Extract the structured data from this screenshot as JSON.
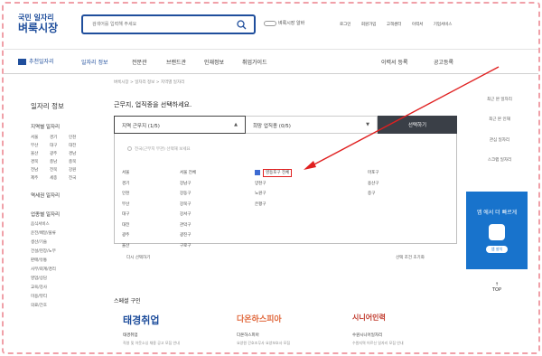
{
  "logo": {
    "line1": "국민 일자리",
    "line2": "벼룩시장"
  },
  "search": {
    "placeholder": "검색어를 입력해 주세요"
  },
  "header": {
    "chip": "벼룩시장 알바",
    "links": [
      "로그인",
      "회원가입",
      "고객센터",
      "이력서",
      "기업서비스"
    ]
  },
  "nav": {
    "first": "추천일자리",
    "items": [
      "일자리 정보",
      "전문관",
      "브랜드관",
      "인재정보",
      "취업가이드"
    ],
    "right": [
      "이력서 등록",
      "공고등록"
    ]
  },
  "breadcrumb": "벼룩시장 > 일자리 정보 > 지역별 일자리",
  "sidebar": {
    "title": "일자리 정보",
    "region_title": "지역별 일자리",
    "regions": [
      "서울",
      "경기",
      "인천",
      "부산",
      "대구",
      "대전",
      "울산",
      "광주",
      "경남",
      "경북",
      "충남",
      "충북",
      "전남",
      "전북",
      "강원",
      "제주",
      "세종",
      "전국"
    ],
    "link2": "역세권 일자리",
    "job_title": "업종별 일자리",
    "jobs": [
      "음식서비스",
      "운전/배달/물류",
      "생산/기술",
      "건설/현장/노무",
      "판매/유통",
      "사무/회계/경리",
      "영업/상담",
      "교육/강사",
      "미용/뷰티",
      "의료/간호"
    ]
  },
  "main": {
    "question": "근무지, 업직종을 선택하세요.",
    "select1": "지역 근무지 (1/5)",
    "select2": "희망 업직종 (0/5)",
    "button": "선택하기",
    "note": "전국(근무지 무관) 선택해 보세요",
    "col1": [
      "서울",
      "경기",
      "인천",
      "부산",
      "대구",
      "대전",
      "광주",
      "울산"
    ],
    "col2": [
      "서울 전체",
      "강남구",
      "강동구",
      "강북구",
      "강서구",
      "관악구",
      "광진구",
      "구로구"
    ],
    "col3_selected": "영등포구 전체",
    "col3": [
      "양천구",
      "노원구",
      "은평구"
    ],
    "col4": [
      "마포구",
      "용산구",
      "중구"
    ],
    "reset": "다시 선택하기",
    "reset2": "선택 조건 초기화"
  },
  "special": {
    "title": "스페셜 구인",
    "cards": [
      {
        "logo": "태경취업",
        "name": "태경취업",
        "desc": "직영 및 아웃소싱 채용 공고 모집 안내"
      },
      {
        "logo": "다온하스피아",
        "name": "다온하스피아",
        "desc": "요양원 간호조무사 요양보호사 모집"
      },
      {
        "logo": "시니어인력",
        "name": "수원시니어일자리",
        "desc": "수원지역 어르신 일자리 모집 안내"
      }
    ]
  },
  "right": {
    "links": [
      "최근 본 일자리",
      "최근 본 인재",
      "관심 일자리",
      "스크랩 일자리"
    ],
    "banner": "앱 에서 더 빠르게",
    "banner_btn": "앱 설치",
    "top": "TOP"
  },
  "colors": {
    "brand": "#1f4e9c",
    "accent": "#e02020",
    "banner": "#1873cc"
  }
}
